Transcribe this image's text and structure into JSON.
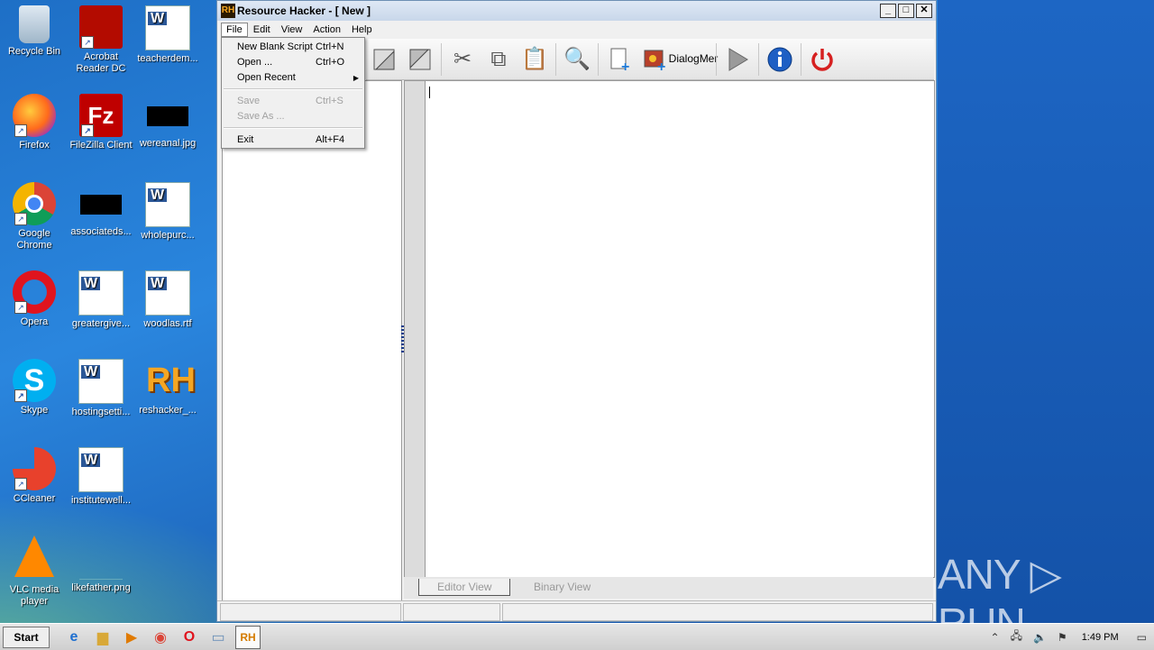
{
  "desktop": {
    "icons": [
      {
        "label": "Recycle Bin",
        "icon": "recycle-bin-icon"
      },
      {
        "label": "Acrobat Reader DC",
        "icon": "acrobat-icon"
      },
      {
        "label": "teacherdem...",
        "icon": "word-doc-icon"
      },
      {
        "label": "Firefox",
        "icon": "firefox-icon"
      },
      {
        "label": "FileZilla Client",
        "icon": "filezilla-icon"
      },
      {
        "label": "wereanal.jpg",
        "icon": "image-file-icon"
      },
      {
        "label": "Google Chrome",
        "icon": "chrome-icon"
      },
      {
        "label": "associateds...",
        "icon": "file-icon"
      },
      {
        "label": "wholepurc...",
        "icon": "word-doc-icon"
      },
      {
        "label": "Opera",
        "icon": "opera-icon"
      },
      {
        "label": "greatergive...",
        "icon": "word-doc-icon"
      },
      {
        "label": "woodlas.rtf",
        "icon": "word-doc-icon"
      },
      {
        "label": "Skype",
        "icon": "skype-icon"
      },
      {
        "label": "hostingsetti...",
        "icon": "word-doc-icon"
      },
      {
        "label": "reshacker_...",
        "icon": "reshacker-icon"
      },
      {
        "label": "CCleaner",
        "icon": "ccleaner-icon"
      },
      {
        "label": "institutewell...",
        "icon": "word-doc-icon"
      },
      {
        "label": "VLC media player",
        "icon": "vlc-icon"
      },
      {
        "label": "likefather.png",
        "icon": "image-file-icon"
      }
    ]
  },
  "window": {
    "title": "Resource Hacker - [ New ]",
    "title_icon": "RH",
    "controls": {
      "minimize": "_",
      "maximize": "□",
      "close": "✕"
    }
  },
  "menubar": {
    "items": [
      "File",
      "Edit",
      "View",
      "Action",
      "Help"
    ]
  },
  "file_menu": {
    "items": [
      {
        "label": "New Blank Script",
        "shortcut": "Ctrl+N",
        "disabled": false
      },
      {
        "label": "Open ...",
        "shortcut": "Ctrl+O",
        "disabled": false
      },
      {
        "label": "Open Recent",
        "shortcut": "",
        "disabled": false,
        "submenu_arrow": "▶"
      },
      {
        "label": "Save",
        "shortcut": "Ctrl+S",
        "disabled": true
      },
      {
        "label": "Save As ...",
        "shortcut": "",
        "disabled": true
      },
      {
        "label": "Exit",
        "shortcut": "Alt+F4",
        "disabled": false
      }
    ]
  },
  "toolbar": {
    "dialog_menu_label_1": "Dialog",
    "dialog_menu_label_2": "Mer"
  },
  "editor": {
    "tabs": [
      "Editor View",
      "Binary View"
    ]
  },
  "taskbar": {
    "start_label": "Start",
    "clock": "1:49 PM"
  },
  "watermark": "ANY ▷ RUN",
  "colors": {
    "desktop": "#2a86de",
    "window_bg": "#f0f0f0",
    "titlebar": "#c9d7ea",
    "power_red": "#d62020",
    "info_blue": "#1e5fc4"
  }
}
